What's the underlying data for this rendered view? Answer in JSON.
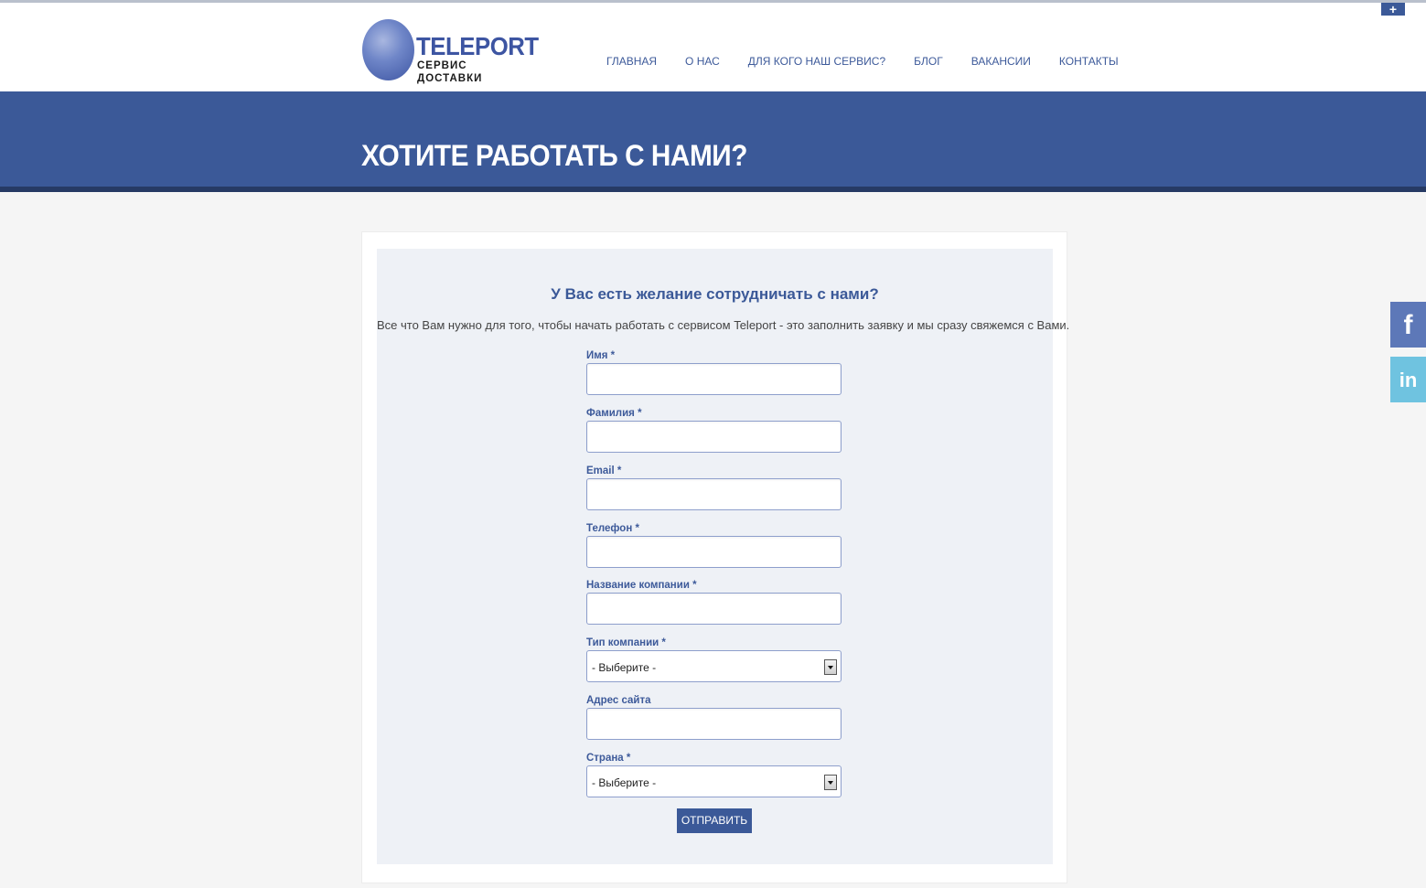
{
  "brand": {
    "name": "TELEPORT",
    "tagline": "СЕРВИС ДОСТАВКИ"
  },
  "top_plus_icon": "+",
  "nav": [
    {
      "label": "ГЛАВНАЯ"
    },
    {
      "label": "О НАС"
    },
    {
      "label": "ДЛЯ КОГО НАШ СЕРВИС?"
    },
    {
      "label": "БЛОГ"
    },
    {
      "label": "ВАКАНСИИ"
    },
    {
      "label": "КОНТАКТЫ"
    }
  ],
  "banner": {
    "title": "ХОТИТЕ РАБОТАТЬ С НАМИ?"
  },
  "form": {
    "title": "У Вас есть желание сотрудничать с нами?",
    "intro": "Все что Вам нужно для того, чтобы начать работать с сервисом Teleport - это заполнить заявку и мы сразу свяжемся с Вами.",
    "fields": [
      {
        "label": "Имя *",
        "value": ""
      },
      {
        "label": "Фамилия *",
        "value": ""
      },
      {
        "label": "Email *",
        "value": ""
      },
      {
        "label": "Телефон *",
        "value": ""
      },
      {
        "label": "Название компании *",
        "value": ""
      },
      {
        "label": "Тип компании *",
        "selected": "- Выберите -"
      },
      {
        "label": "Адрес сайта",
        "value": ""
      },
      {
        "label": "Страна *",
        "selected": "- Выберите -"
      }
    ],
    "submit_label": "ОТПРАВИТЬ"
  },
  "social": {
    "facebook_glyph": "f",
    "linkedin_glyph": "in"
  },
  "colors": {
    "brand_blue": "#3b5998",
    "banner_dark": "#263a64",
    "form_bg": "#eef1f6",
    "linkedin": "#6fc3e0",
    "facebook": "#5d78b8"
  }
}
